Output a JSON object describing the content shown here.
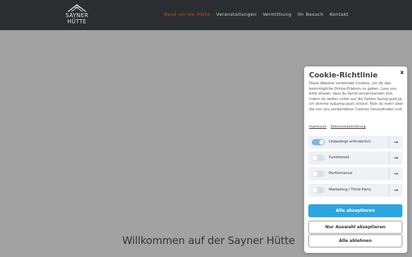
{
  "header": {
    "logo_line1": "SAYNER",
    "logo_line2": "HÜTTE",
    "nav": [
      {
        "label": "Rund um die Hütte",
        "active": true
      },
      {
        "label": "Veranstaltungen",
        "active": false
      },
      {
        "label": "Vermittlung",
        "active": false
      },
      {
        "label": "Ihr Besuch",
        "active": false
      },
      {
        "label": "Kontakt",
        "active": false
      }
    ]
  },
  "hero": {
    "title": "Willkommen auf der Sayner Hütte"
  },
  "cookie": {
    "close": "x",
    "title": "Cookie-Richtlinie",
    "text": "Diese Website verwendet Cookies, um dir das bestmögliche Online-Erlebnis zu geben. Lass uns bitte wissen, dass du damit einverstanden bist, indem du weiter unten auf die Option &amp;quot;ja, ich stimme zu&amp;quot; klickst. Falls du mehr über die von uns verwendeten Cookies herausfinden und",
    "link_impressum": "Impressum",
    "link_privacy": "Datenschutzerklärung",
    "categories": [
      {
        "label": "Unbedingt erforderlich",
        "enabled": true
      },
      {
        "label": "Funktionell",
        "enabled": false
      },
      {
        "label": "Performance",
        "enabled": false
      },
      {
        "label": "Marketing / Third Party",
        "enabled": false
      }
    ],
    "arrow": "→",
    "accept_all": "Alle akzeptieren",
    "accept_selection": "Nur Auswahl akzeptieren",
    "reject_all": "Alle ablehnen"
  },
  "colors": {
    "header_bg": "#2b2e30",
    "nav_active": "#c9542a",
    "page_bg": "#a2a2a2",
    "primary_button": "#2aa7e0"
  }
}
